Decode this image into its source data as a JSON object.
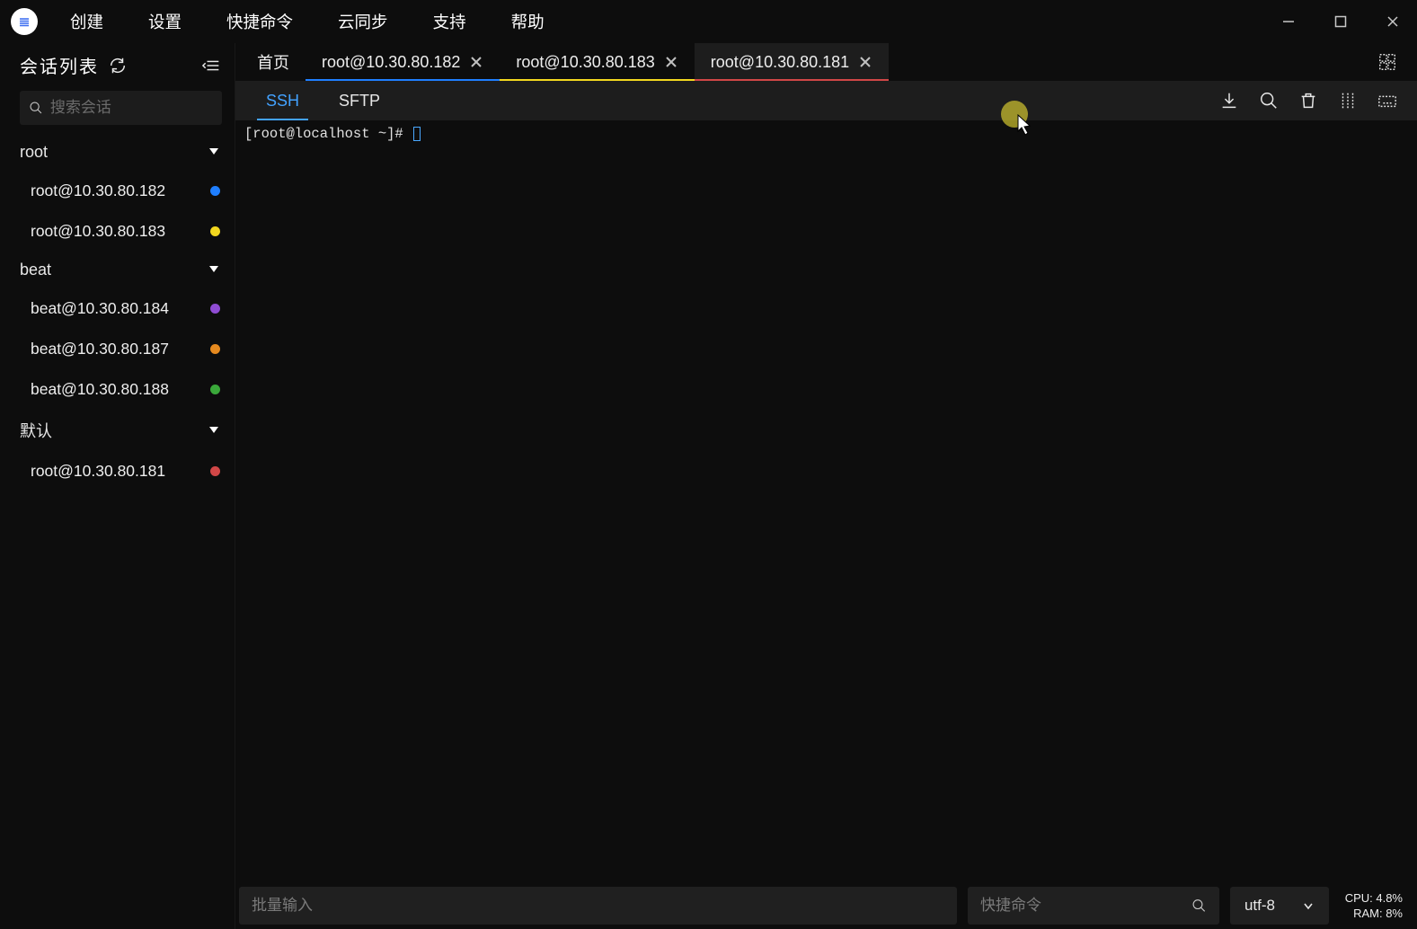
{
  "menu": {
    "items": [
      "创建",
      "设置",
      "快捷命令",
      "云同步",
      "支持",
      "帮助"
    ]
  },
  "sidebar": {
    "title": "会话列表",
    "search_placeholder": "搜索会话",
    "groups": [
      {
        "name": "root",
        "sessions": [
          {
            "label": "root@10.30.80.182",
            "color": "#1f7fff"
          },
          {
            "label": "root@10.30.80.183",
            "color": "#f2d71f"
          }
        ]
      },
      {
        "name": "beat",
        "sessions": [
          {
            "label": "beat@10.30.80.184",
            "color": "#8f4cd3"
          },
          {
            "label": "beat@10.30.80.187",
            "color": "#e68a1f"
          },
          {
            "label": "beat@10.30.80.188",
            "color": "#3aa83a"
          }
        ]
      },
      {
        "name": "默认",
        "sessions": [
          {
            "label": "root@10.30.80.181",
            "color": "#d14747"
          }
        ]
      }
    ]
  },
  "tabs": {
    "items": [
      {
        "label": "首页",
        "closable": false,
        "border": "",
        "active": false
      },
      {
        "label": "root@10.30.80.182",
        "closable": true,
        "border": "#1f7fff",
        "active": false
      },
      {
        "label": "root@10.30.80.183",
        "closable": true,
        "border": "#f2d71f",
        "active": false
      },
      {
        "label": "root@10.30.80.181",
        "closable": true,
        "border": "#d14747",
        "active": true
      }
    ]
  },
  "subtabs": {
    "ssh": "SSH",
    "sftp": "SFTP"
  },
  "terminal": {
    "prompt": "[root@localhost ~]# "
  },
  "bottom": {
    "batch_placeholder": "批量输入",
    "quick_placeholder": "快捷命令",
    "encoding": "utf-8"
  },
  "stats": {
    "cpu": "CPU: 4.8%",
    "ram": "RAM: 8%"
  }
}
